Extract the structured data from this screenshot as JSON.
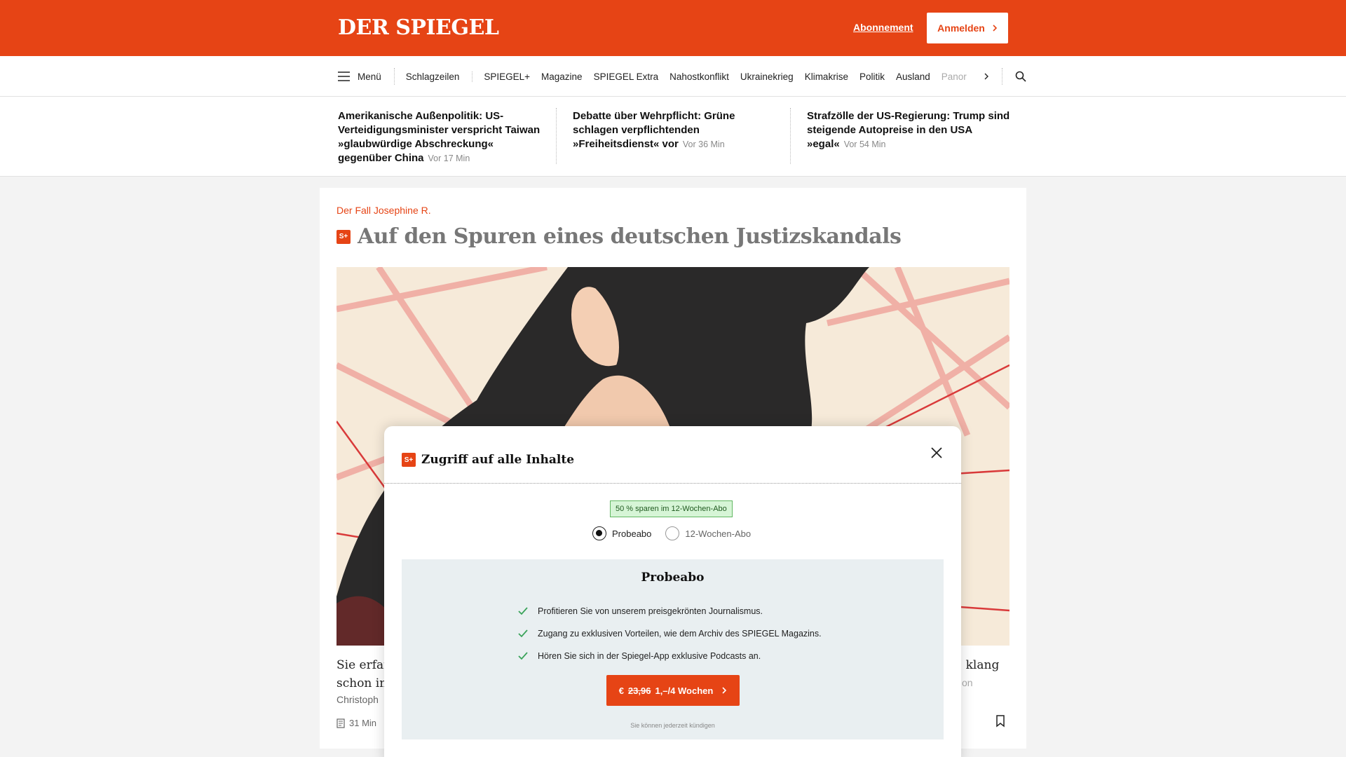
{
  "header": {
    "logo": "DER SPIEGEL",
    "subscription_link": "Abonnement",
    "login_button": "Anmelden"
  },
  "nav": {
    "menu_label": "Menü",
    "items": [
      "Schlagzeilen",
      "SPIEGEL+",
      "Magazine",
      "SPIEGEL Extra",
      "Nahostkonflikt",
      "Ukrainekrieg",
      "Klimakrise",
      "Politik",
      "Ausland",
      "Panor"
    ]
  },
  "headlines": [
    {
      "title": "Amerikanische Außenpolitik: US-Verteidigungsminister verspricht Taiwan »glaubwürdige Abschreckung« gegenüber China",
      "time": "Vor 17 Min"
    },
    {
      "title": "Debatte über Wehrpflicht: Grüne schlagen verpflichtenden »Freiheitsdienst« vor",
      "time": "Vor 36 Min"
    },
    {
      "title": "Strafzölle der US-Regierung: Trump sind steigende Autopreise in den USA »egal«",
      "time": "Vor 54 Min"
    }
  ],
  "article": {
    "kicker": "Der Fall Josephine R.",
    "badge": "S+",
    "title": "Auf den Spuren eines deutschen Justizskandals",
    "teaser_left_line1": "Sie erfan",
    "teaser_left_line2": "schon im",
    "author": "Christoph",
    "teaser_right": "... klang",
    "author_right": "on",
    "read_time": "31 Min"
  },
  "modal": {
    "badge": "S+",
    "title": "Zugriff auf alle Inhalte",
    "save_badge": "50 % sparen im 12-Wochen-Abo",
    "options": [
      {
        "label": "Probeabo",
        "selected": true
      },
      {
        "label": "12-Wochen-Abo",
        "selected": false
      }
    ],
    "offer": {
      "title": "Probeabo",
      "benefits": [
        "Profitieren Sie von unserem preisgekrönten Journalismus.",
        "Zugang zu exklusiven Vorteilen, wie dem Archiv des SPIEGEL Magazins.",
        "Hören Sie sich in der Spiegel-App exklusive Podcasts an."
      ],
      "cta_prefix": "€",
      "cta_old_price": "23,96",
      "cta_new_price": "1,–/4 Wochen",
      "cancel_note": "Sie können jederzeit kündigen"
    }
  },
  "colors": {
    "brand": "#e64415",
    "check": "#3aa35a",
    "save_badge_bg": "#d6f5d6",
    "offer_bg": "#e9eff1"
  },
  "icons": [
    "hamburger-icon",
    "chevron-right-icon",
    "search-icon",
    "close-icon",
    "check-icon",
    "article-icon",
    "bookmark-icon"
  ]
}
